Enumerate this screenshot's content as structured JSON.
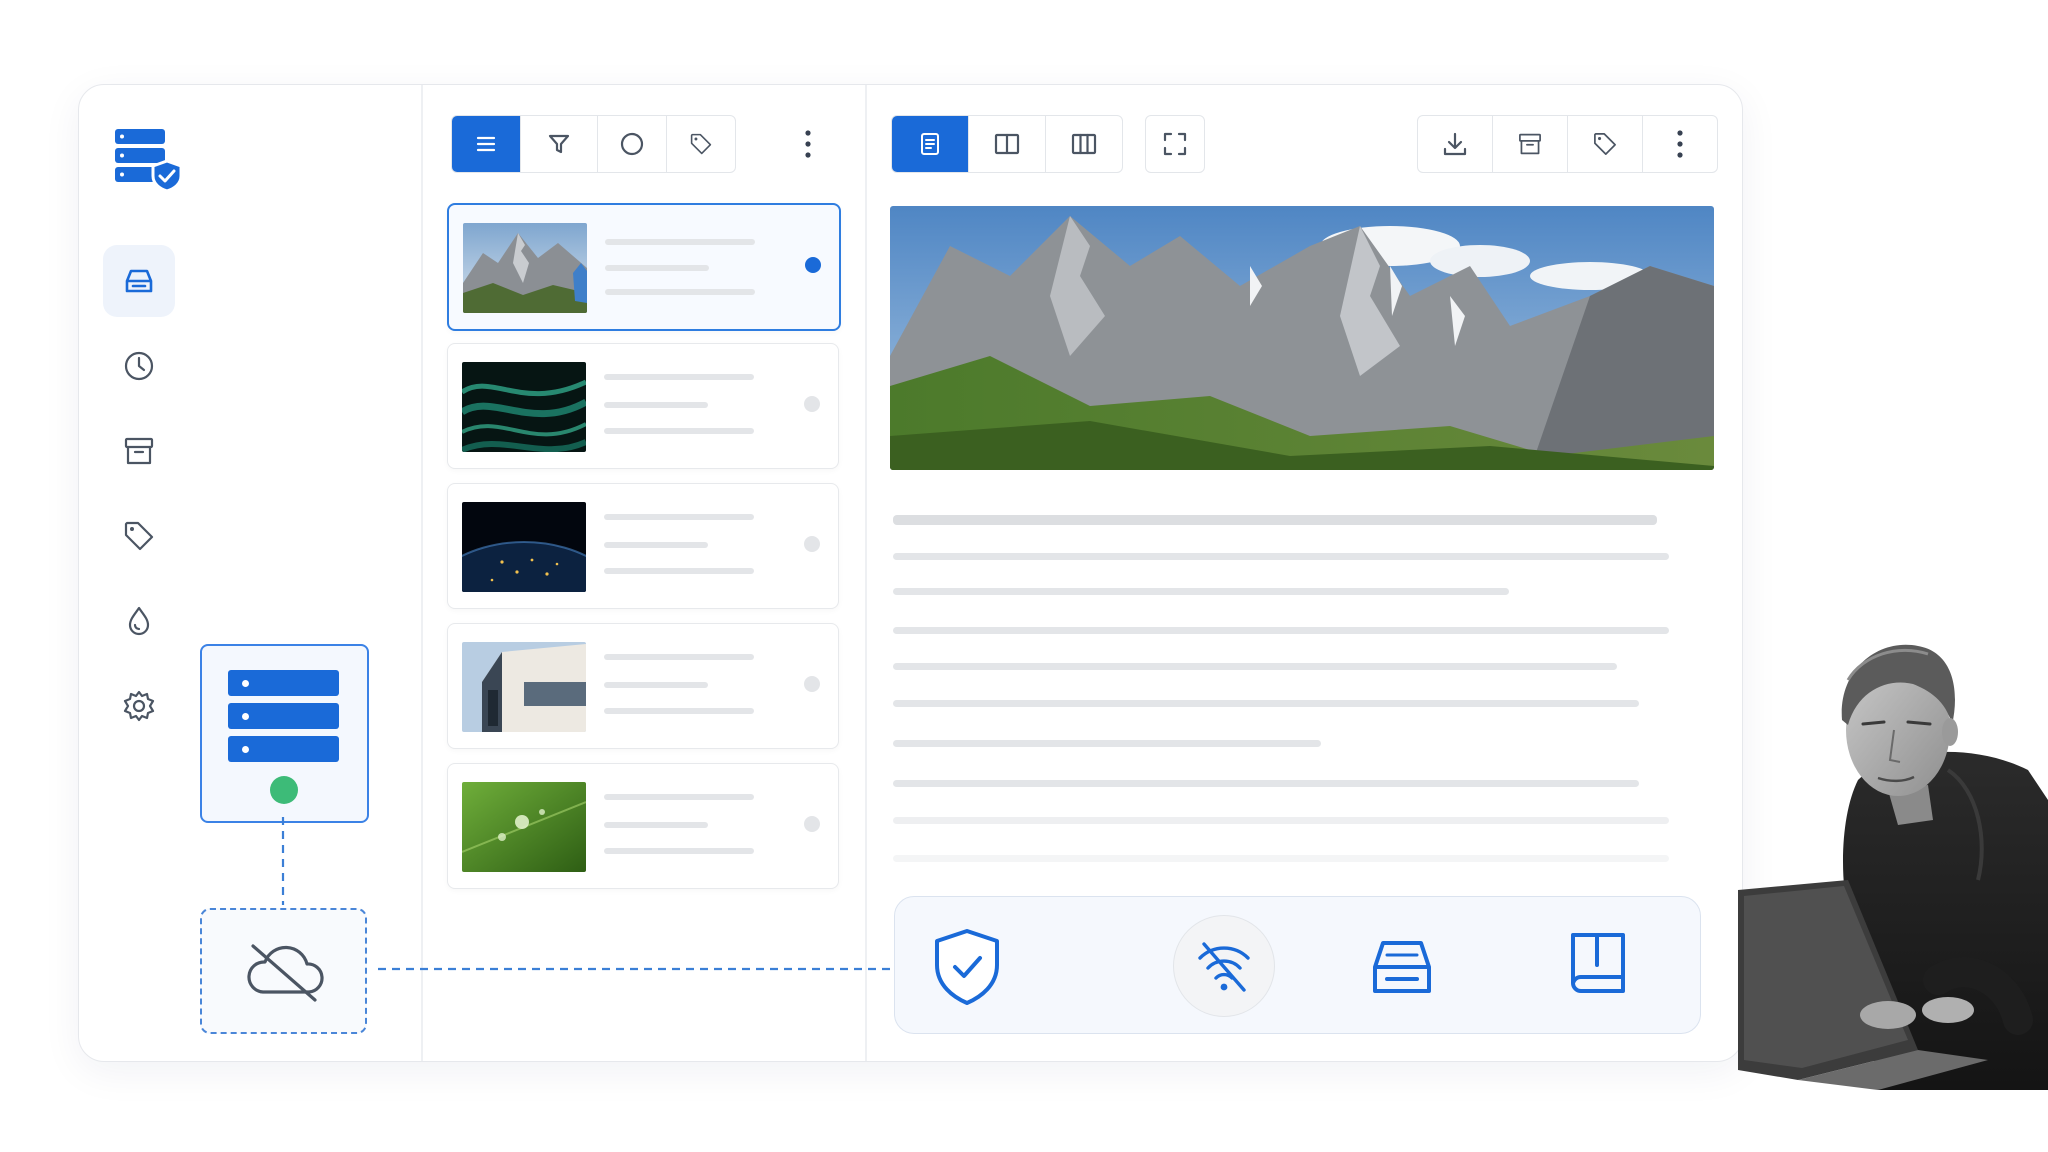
{
  "app": {
    "brand": "server-shield-logo",
    "accent_color": "#1a6ad8",
    "sidebar": {
      "items": [
        {
          "icon": "inbox-tray-icon",
          "active": true
        },
        {
          "icon": "clock-icon",
          "active": false
        },
        {
          "icon": "archive-icon",
          "active": false
        },
        {
          "icon": "tag-icon",
          "active": false
        },
        {
          "icon": "drop-icon",
          "active": false
        },
        {
          "icon": "gear-icon",
          "active": false
        }
      ]
    },
    "list_toolbar": {
      "buttons": [
        "list-view-icon",
        "filter-icon",
        "circle-icon",
        "tag-icon"
      ],
      "active": "list-view-icon",
      "more": "more-vertical-icon"
    },
    "list": {
      "items": [
        {
          "thumbnail": "mountain-photo",
          "selected": true
        },
        {
          "thumbnail": "green-waves-photo",
          "selected": false
        },
        {
          "thumbnail": "earth-night-photo",
          "selected": false
        },
        {
          "thumbnail": "building-photo",
          "selected": false
        },
        {
          "thumbnail": "leaf-droplet-photo",
          "selected": false
        }
      ]
    },
    "reader_toolbar": {
      "layout_buttons": [
        "document-icon",
        "two-column-icon",
        "three-column-icon"
      ],
      "active": "document-icon",
      "fullscreen": "fullscreen-icon",
      "actions": [
        "download-icon",
        "archive-icon",
        "tag-icon",
        "more-vertical-icon"
      ]
    },
    "reader": {
      "hero_image": "mountain-panorama"
    },
    "status_bar": {
      "icons": [
        "shield-check-icon",
        "wifi-off-icon",
        "inbox-tray-icon",
        "book-icon"
      ]
    },
    "sync_diagram": {
      "server_status_color": "#3dbb78",
      "cloud": "cloud-off-icon"
    }
  }
}
